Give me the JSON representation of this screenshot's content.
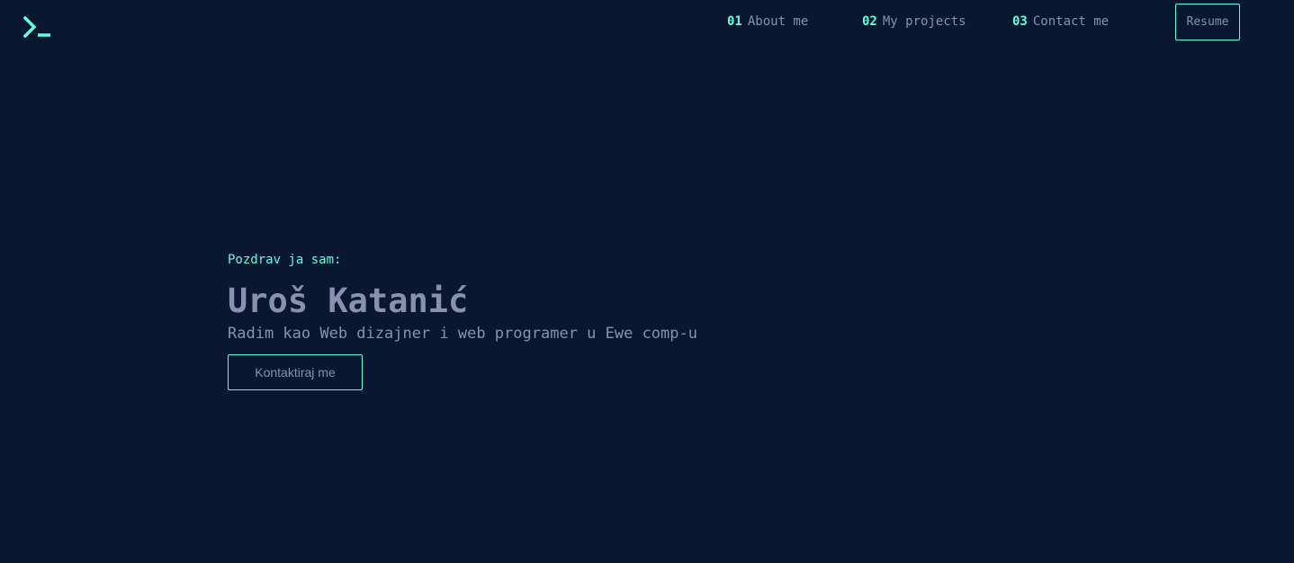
{
  "header": {
    "logo_icon": "terminal-prompt-icon",
    "nav": [
      {
        "num": "01",
        "label": "About me"
      },
      {
        "num": "02",
        "label": "My projects"
      },
      {
        "num": "03",
        "label": "Contact me"
      }
    ],
    "resume_label": "Resume"
  },
  "hero": {
    "greeting": "Pozdrav ja sam:",
    "name": "Uroš Katanić",
    "tagline": "Radim kao Web dizajner i web programer u Ewe comp-u",
    "cta_label": "Kontaktiraj me"
  },
  "colors": {
    "background": "#0a1730",
    "accent": "#64ffda",
    "text": "#8892b0"
  }
}
